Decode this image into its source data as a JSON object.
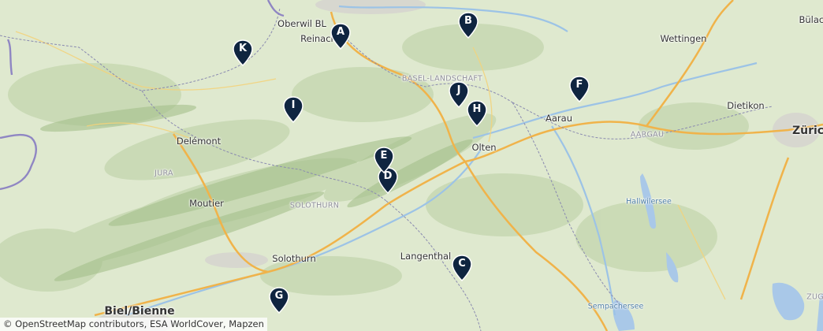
{
  "map": {
    "place_labels": [
      {
        "name": "Oberwil BL",
        "kind": "city"
      },
      {
        "name": "Reinach",
        "kind": "city"
      },
      {
        "name": "Wettingen",
        "kind": "city"
      },
      {
        "name": "Bülach",
        "kind": "city"
      },
      {
        "name": "BASEL-LANDSCHAFT",
        "kind": "region"
      },
      {
        "name": "Dietikon",
        "kind": "city"
      },
      {
        "name": "Aarau",
        "kind": "city"
      },
      {
        "name": "Zürich",
        "kind": "big"
      },
      {
        "name": "Delémont",
        "kind": "city"
      },
      {
        "name": "AARGAU",
        "kind": "region"
      },
      {
        "name": "Olten",
        "kind": "city"
      },
      {
        "name": "JURA",
        "kind": "region"
      },
      {
        "name": "Hallwilersee",
        "kind": "lake"
      },
      {
        "name": "Moutier",
        "kind": "city"
      },
      {
        "name": "SOLOTHURN",
        "kind": "region"
      },
      {
        "name": "Solothurn",
        "kind": "city"
      },
      {
        "name": "Langenthal",
        "kind": "city"
      },
      {
        "name": "Biel/Bienne",
        "kind": "big"
      },
      {
        "name": "Sempachersee",
        "kind": "lake"
      },
      {
        "name": "ZUG",
        "kind": "region"
      }
    ],
    "markers": [
      {
        "label": "A"
      },
      {
        "label": "B"
      },
      {
        "label": "C"
      },
      {
        "label": "D"
      },
      {
        "label": "E"
      },
      {
        "label": "F"
      },
      {
        "label": "G"
      },
      {
        "label": "H"
      },
      {
        "label": "I"
      },
      {
        "label": "J"
      },
      {
        "label": "K"
      }
    ],
    "marker_color": "#0f2540",
    "attribution": "© OpenStreetMap contributors, ESA WorldCover, Mapzen"
  }
}
